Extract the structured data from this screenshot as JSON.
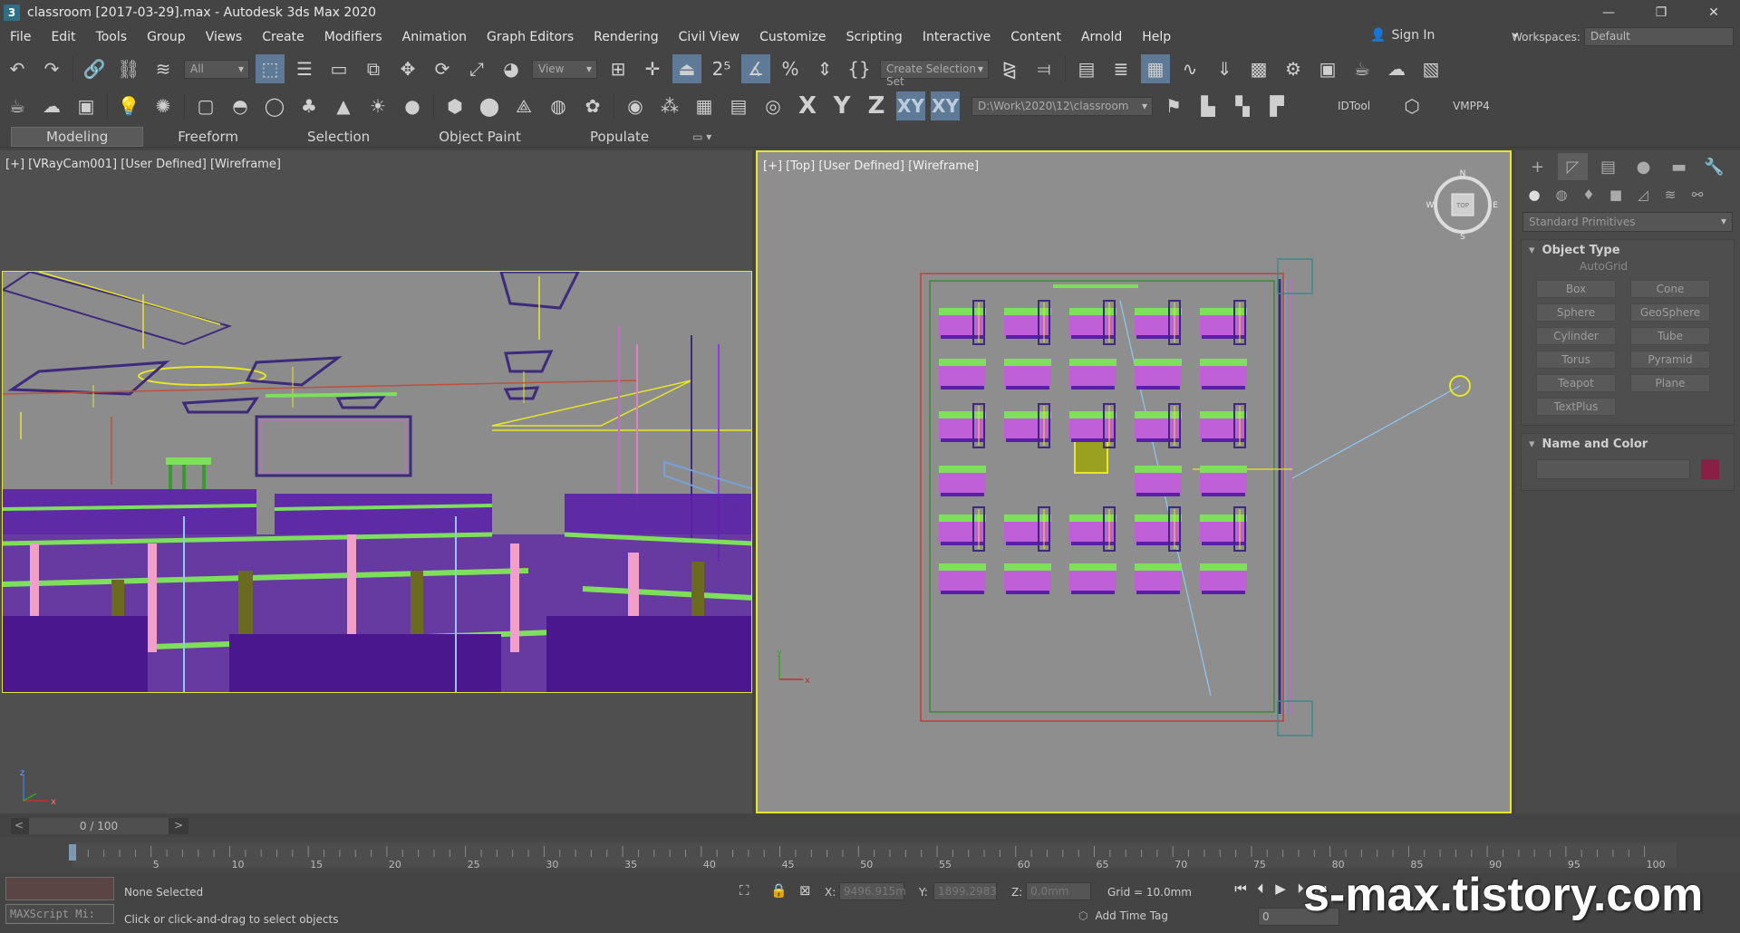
{
  "window": {
    "title": "classroom [2017-03-29].max - Autodesk 3ds Max 2020",
    "app_icon": "3",
    "controls": [
      "minimize-icon",
      "restore-icon",
      "close-icon"
    ]
  },
  "menu": {
    "items": [
      "File",
      "Edit",
      "Tools",
      "Group",
      "Views",
      "Create",
      "Modifiers",
      "Animation",
      "Graph Editors",
      "Rendering",
      "Civil View",
      "Customize",
      "Scripting",
      "Interactive",
      "Content",
      "Arnold",
      "Help"
    ],
    "sign_in": "Sign In",
    "workspaces_label": "Workspaces:",
    "workspace_value": "Default"
  },
  "toolbar1": {
    "filter_value": "All",
    "coord_system": "View",
    "selection_set": "Create Selection Set"
  },
  "toolbar2": {
    "project_path": "D:\\Work\\2020\\12\\classroom",
    "idtool_label": "IDTool",
    "vmpp_label": "VMPP4",
    "axis_x": "X",
    "axis_y": "Y",
    "axis_z": "Z",
    "axis_xy": "XY",
    "axis_xy2": "XY"
  },
  "ribbon": {
    "tabs": [
      "Modeling",
      "Freeform",
      "Selection",
      "Object Paint",
      "Populate"
    ],
    "active": "Modeling"
  },
  "viewports": {
    "left_label": "[+] [VRayCam001] [User Defined] [Wireframe]",
    "top_label": "[+] [Top] [User Defined] [Wireframe]",
    "viewcube": {
      "n": "N",
      "s": "S",
      "e": "E",
      "w": "W",
      "face": "TOP"
    },
    "axis_x": "x",
    "axis_y": "y",
    "axis_z": "z"
  },
  "command_panel": {
    "dropdown": "Standard Primitives",
    "object_type_title": "Object Type",
    "autogrid": "AutoGrid",
    "primitives": [
      "Box",
      "Cone",
      "Sphere",
      "GeoSphere",
      "Cylinder",
      "Tube",
      "Torus",
      "Pyramid",
      "Teapot",
      "Plane",
      "TextPlus"
    ],
    "name_color_title": "Name and Color",
    "object_color": "#8a1f46"
  },
  "timeline": {
    "position": "0 / 100",
    "ticks": [
      0,
      5,
      10,
      15,
      20,
      25,
      30,
      35,
      40,
      45,
      50,
      55,
      60,
      65,
      70,
      75,
      80,
      85,
      90,
      95,
      100
    ]
  },
  "status": {
    "maxscript": "MAXScript Mi:",
    "selection": "None Selected",
    "prompt": "Click or click-and-drag to select objects",
    "x_label": "X:",
    "x_value": "9496.915m",
    "y_label": "Y:",
    "y_value": "1899.2983",
    "z_label": "Z:",
    "z_value": "0.0mm",
    "grid": "Grid = 10.0mm",
    "add_time_tag": "Add Time Tag",
    "frame": "0"
  },
  "watermark": "s-max.tistory.com"
}
